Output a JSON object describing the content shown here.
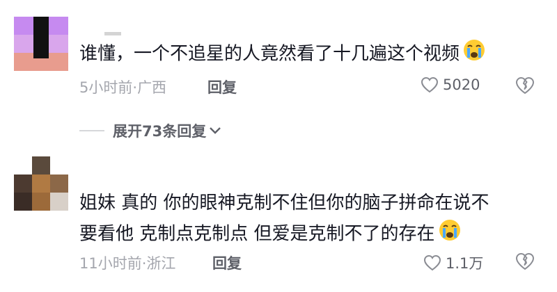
{
  "comments": [
    {
      "text_lines": [
        "谁懂，一个不追星的人竟然看了十几遍这个视频"
      ],
      "time": "5小时前",
      "location": "广西",
      "reply_label": "回复",
      "likes": "5020"
    },
    {
      "text_lines": [
        "姐妹 真的 你的眼神克制不住但你的脑子拼命在说不",
        "要看他 克制点克制点 但爱是克制不了的存在"
      ],
      "time": "11小时前",
      "location": "浙江",
      "reply_label": "回复",
      "likes": "1.1万"
    }
  ],
  "expand_replies": {
    "label": "展开73条回复"
  },
  "icons": {
    "like": "heart-outline-icon",
    "dislike": "broken-heart-icon",
    "emoji": "crying-face-emoji-icon",
    "expand": "chevron-down-icon"
  },
  "colors": {
    "text": "#161823",
    "meta": "#a4a6ad",
    "action": "#5e6068"
  }
}
